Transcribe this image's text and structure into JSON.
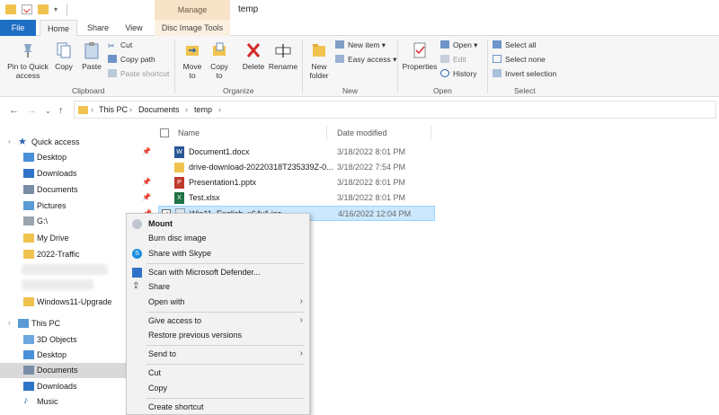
{
  "window": {
    "title": "temp",
    "contextual_tab": "Manage"
  },
  "tabs": [
    "File",
    "Home",
    "Share",
    "View",
    "Disc Image Tools"
  ],
  "ribbon": {
    "clipboard": {
      "pin": "Pin to Quick access",
      "copy": "Copy",
      "paste": "Paste",
      "cut": "Cut",
      "copy_path": "Copy path",
      "paste_shortcut": "Paste shortcut",
      "group": "Clipboard"
    },
    "organize": {
      "move_to": "Move to",
      "copy_to": "Copy to",
      "delete": "Delete",
      "rename": "Rename",
      "group": "Organize"
    },
    "new": {
      "new_folder": "New folder",
      "new_item": "New item",
      "easy_access": "Easy access",
      "group": "New"
    },
    "open": {
      "properties": "Properties",
      "open": "Open",
      "edit": "Edit",
      "history": "History",
      "group": "Open"
    },
    "select": {
      "select_all": "Select all",
      "select_none": "Select none",
      "invert": "Invert selection",
      "group": "Select"
    }
  },
  "address": {
    "crumbs": [
      "This PC",
      "Documents",
      "temp"
    ]
  },
  "nav": {
    "quick_access": "Quick access",
    "items": [
      "Desktop",
      "Downloads",
      "Documents",
      "Pictures",
      "G:\\",
      "My Drive",
      "2022-Traffic",
      "Windows11-Upgrade"
    ],
    "this_pc": "This PC",
    "pc_items": [
      "3D Objects",
      "Desktop",
      "Documents",
      "Downloads",
      "Music"
    ]
  },
  "columns": {
    "name": "Name",
    "date": "Date modified"
  },
  "files": [
    {
      "name": "Document1.docx",
      "date": "3/18/2022 8:01 PM"
    },
    {
      "name": "drive-download-20220318T235339Z-0...",
      "date": "3/18/2022 7:54 PM"
    },
    {
      "name": "Presentation1.pptx",
      "date": "3/18/2022 8:01 PM"
    },
    {
      "name": "Test.xlsx",
      "date": "3/18/2022 8:01 PM"
    },
    {
      "name": "Win11_English_x64v1.iso",
      "date": "4/16/2022 12:04 PM"
    }
  ],
  "context_menu": [
    "Mount",
    "Burn disc image",
    "Share with Skype",
    "Scan with Microsoft Defender...",
    "Share",
    "Open with",
    "Give access to",
    "Restore previous versions",
    "Send to",
    "Cut",
    "Copy",
    "Create shortcut"
  ],
  "colors": {
    "file_tab": "#1e6fc4",
    "manage_tab": "#f7e3c8",
    "selection": "#cce8ff",
    "folder": "#f0c24f"
  }
}
